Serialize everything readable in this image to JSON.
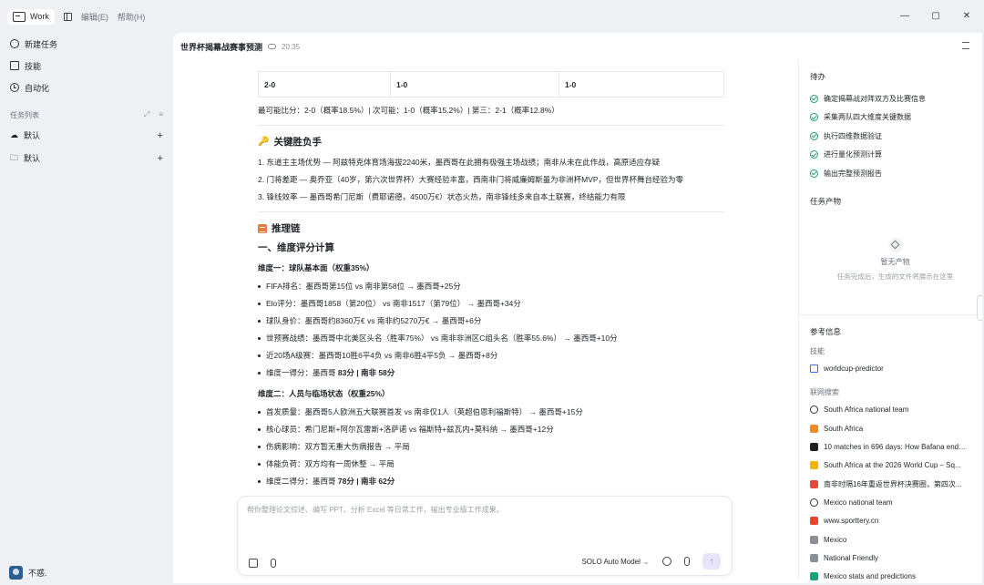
{
  "titlebar": {
    "app_name": "Work",
    "menu": [
      "编辑(E)",
      "帮助(H)"
    ],
    "controls": [
      "—",
      "▢",
      "✕"
    ]
  },
  "sidebar": {
    "nav": [
      {
        "label": "新建任务",
        "icon": "plus-circle-icon"
      },
      {
        "label": "技能",
        "icon": "book-icon"
      },
      {
        "label": "自动化",
        "icon": "clock-icon"
      }
    ],
    "task_list_label": "任务列表",
    "groups": [
      {
        "label": "默认",
        "icon": "cloud-icon"
      },
      {
        "label": "默认",
        "icon": "folder-icon"
      }
    ],
    "user_name": "不惑."
  },
  "main": {
    "title": "世界杯揭幕战赛事预测",
    "time": "20:35"
  },
  "content": {
    "score_row": [
      "2-0",
      "1-0",
      "1-0"
    ],
    "probable_scores": "最可能比分：2-0（概率18.5%）| 次可能：1-0（概率15.2%）| 第三：2-1（概率12.8%）",
    "key_factors_title": "关键胜负手",
    "key_factors": [
      "1. 东道主主场优势 — 阿兹特克体育场海拔2240米，墨西哥在此拥有极强主场战绩；南非从未在此作战，高原适应存疑",
      "2. 门将差距 — 奥乔亚（40岁，第六次世界杯）大赛经验丰富，西南非门将威廉姆斯虽为非洲杯MVP，但世界杯舞台经验为零",
      "3. 锋线效率 — 墨西哥希门尼斯（费耶诺德，4500万€）状态火热，南非锋线多来自本土联赛，终结能力有限"
    ],
    "chain_title": "推理链",
    "section1_title": "一、维度评分计算",
    "dim1_title": "维度一：球队基本面（权重35%）",
    "dim1_items": [
      "FIFA排名：墨西哥第15位 vs 南非第58位 → 墨西哥+25分",
      "Elo评分：墨西哥1858（第20位） vs 南非1517（第79位） → 墨西哥+34分",
      "球队身价：墨西哥约8360万€ vs 南非约5270万€ → 墨西哥+6分",
      "世预赛战绩：墨西哥中北美区头名（胜率75%） vs 南非非洲区C组头名（胜率55.6%） → 墨西哥+10分",
      "近20场A级赛：墨西哥10胜6平4负 vs 南非6胜4平5负 → 墨西哥+8分"
    ],
    "dim1_score_prefix": "维度一得分：墨西哥 ",
    "dim1_score_mx": "83分",
    "dim1_score_sep": " | 南非 ",
    "dim1_score_za": "58分",
    "dim2_title": "维度二：人员与临场状态（权重25%）",
    "dim2_items": [
      "首发质量：墨西哥5人欧洲五大联赛首发 vs 南非仅1人（英超伯恩利福斯特） → 墨西哥+15分",
      "核心球员：希门尼斯+阿尔瓦雷斯+洛萨诺 vs 福斯特+兹瓦内+莫科纳 → 墨西哥+12分",
      "伤病影响：双方暂无重大伤病报告 → 平局",
      "体能负荷：双方均有一周休整 → 平局"
    ],
    "dim2_score_prefix": "维度二得分：墨西哥 ",
    "dim2_score_mx": "78分",
    "dim2_score_sep": " | 南非 ",
    "dim2_score_za": "62分"
  },
  "composer": {
    "placeholder": "帮你整理论文综述、编写 PPT、分析 Excel 等日常工作，输出专业级工作成果。",
    "model": "SOLO Auto Model"
  },
  "right_panel": {
    "todo_title": "待办",
    "todos": [
      "确定揭幕战对阵双方及比赛信息",
      "采集两队四大维度关键数据",
      "执行四维数据验证",
      "进行量化预测计算",
      "输出完整预测报告"
    ],
    "artifacts_title": "任务产物",
    "empty_title": "暂无产物",
    "empty_desc": "任务完成后，生成的文件将展示在这里",
    "ref_title": "参考信息",
    "skills_label": "技能",
    "skill": "worldcup-predictor",
    "web_label": "联网搜索",
    "refs": [
      {
        "text": "South Africa national team",
        "icon": "globe-icon",
        "color": "#333333"
      },
      {
        "text": "South Africa",
        "icon": "site-icon",
        "color": "#f08a24"
      },
      {
        "text": "10 matches in 696 days: How Bafana ended...",
        "icon": "site-icon",
        "color": "#222222"
      },
      {
        "text": "South Africa at the 2026 World Cup – Sq...",
        "icon": "site-icon",
        "color": "#f5b400"
      },
      {
        "text": "南非时隔16年重返世界杯决赛圈，第四次...",
        "icon": "site-icon",
        "color": "#e24a3b"
      },
      {
        "text": "Mexico national team",
        "icon": "globe-icon",
        "color": "#333333"
      },
      {
        "text": "www.sporttery.cn",
        "icon": "site-icon",
        "color": "#e8442e"
      },
      {
        "text": "Mexico",
        "icon": "site-icon",
        "color": "#8a8f98"
      },
      {
        "text": "National Friendly",
        "icon": "site-icon",
        "color": "#8a8f98"
      },
      {
        "text": "Mexico stats and predictions",
        "icon": "site-icon",
        "color": "#1aa37a"
      }
    ]
  }
}
